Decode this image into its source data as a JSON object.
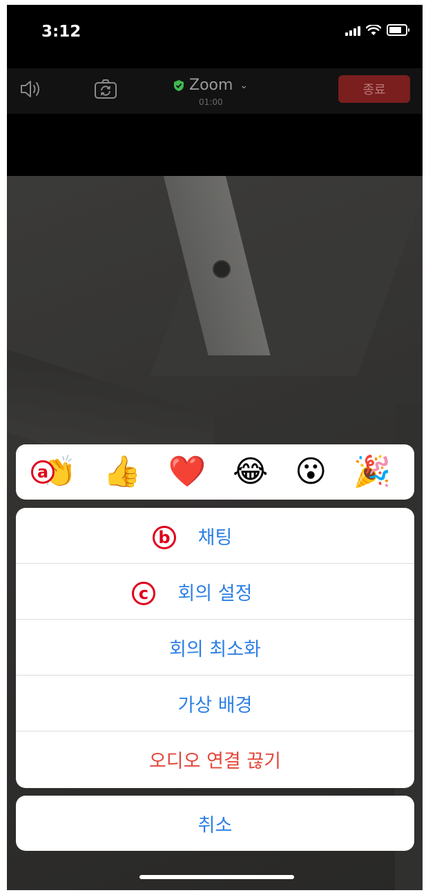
{
  "status_bar": {
    "time": "3:12"
  },
  "toolbar": {
    "meeting_title": "Zoom",
    "timer": "01:00",
    "end_label": "종료",
    "shield_color": "#3fb950",
    "end_color": "#7a1e1e"
  },
  "reactions": [
    {
      "icon": "clapping-hands-icon",
      "glyph": "👏"
    },
    {
      "icon": "thumbs-up-icon",
      "glyph": "👍"
    },
    {
      "icon": "red-heart-icon",
      "glyph": "❤️"
    },
    {
      "icon": "tears-of-joy-icon",
      "glyph": "😂"
    },
    {
      "icon": "surprised-face-icon",
      "glyph": "😮"
    },
    {
      "icon": "party-popper-icon",
      "glyph": "🎉"
    }
  ],
  "markers": {
    "a": "a",
    "b": "b",
    "c": "c"
  },
  "action_sheet": {
    "items": [
      {
        "label": "채팅"
      },
      {
        "label": "회의 설정"
      },
      {
        "label": "회의 최소화"
      },
      {
        "label": "가상 배경"
      },
      {
        "label": "오디오 연결 끊기"
      }
    ]
  },
  "cancel_label": "취소",
  "colors": {
    "action_blue": "#2d7fe6",
    "destructive_red": "#e3473a",
    "marker_red": "#e0001b"
  }
}
